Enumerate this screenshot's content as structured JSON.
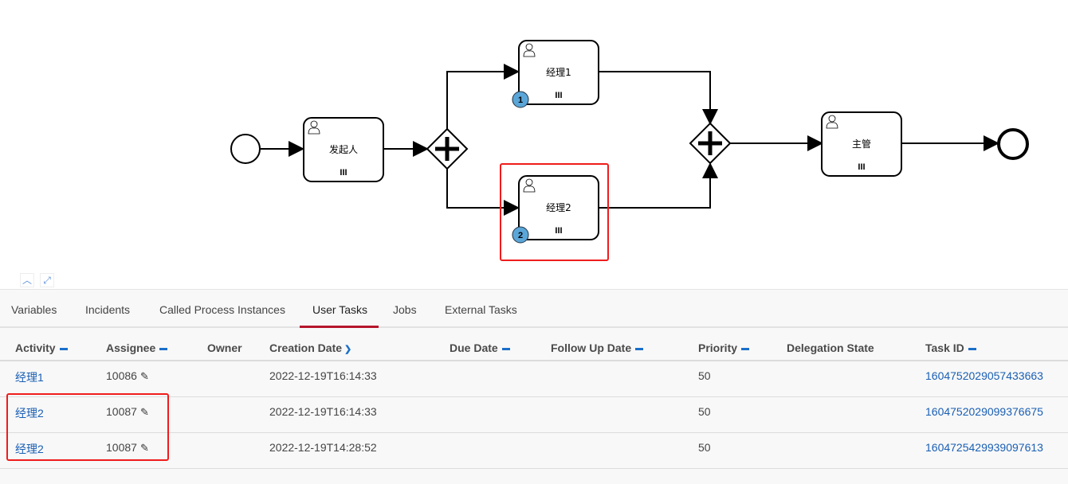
{
  "diagram": {
    "start_event": "start",
    "tasks": [
      {
        "name": "发起人",
        "badge": ""
      },
      {
        "name": "经理1",
        "badge": "1"
      },
      {
        "name": "经理2",
        "badge": "2"
      },
      {
        "name": "主管",
        "badge": ""
      }
    ],
    "multi_instance_marker": "III",
    "highlight_color": "#f01c1c",
    "badge_color": "#5ba6d8"
  },
  "controls": {
    "collapse_icon": "chevron-up-icon",
    "expand_icon": "fullscreen-icon"
  },
  "tabs": [
    {
      "label": "Variables"
    },
    {
      "label": "Incidents"
    },
    {
      "label": "Called Process Instances"
    },
    {
      "label": "User Tasks",
      "active": true
    },
    {
      "label": "Jobs"
    },
    {
      "label": "External Tasks"
    }
  ],
  "table": {
    "columns": [
      "Activity",
      "Assignee",
      "Owner",
      "Creation Date",
      "Due Date",
      "Follow Up Date",
      "Priority",
      "Delegation State",
      "Task ID"
    ],
    "rows": [
      {
        "activity": "经理1",
        "assignee": "10086",
        "owner": "",
        "created": "2022-12-19T16:14:33",
        "due": "",
        "follow": "",
        "priority": "50",
        "delegation": "",
        "task_id": "1604752029057433663"
      },
      {
        "activity": "经理2",
        "assignee": "10087",
        "owner": "",
        "created": "2022-12-19T16:14:33",
        "due": "",
        "follow": "",
        "priority": "50",
        "delegation": "",
        "task_id": "1604752029099376675"
      },
      {
        "activity": "经理2",
        "assignee": "10087",
        "owner": "",
        "created": "2022-12-19T14:28:52",
        "due": "",
        "follow": "",
        "priority": "50",
        "delegation": "",
        "task_id": "1604725429939097613"
      }
    ]
  },
  "accent_color": "#b5152b",
  "link_color": "#1a5fb4"
}
